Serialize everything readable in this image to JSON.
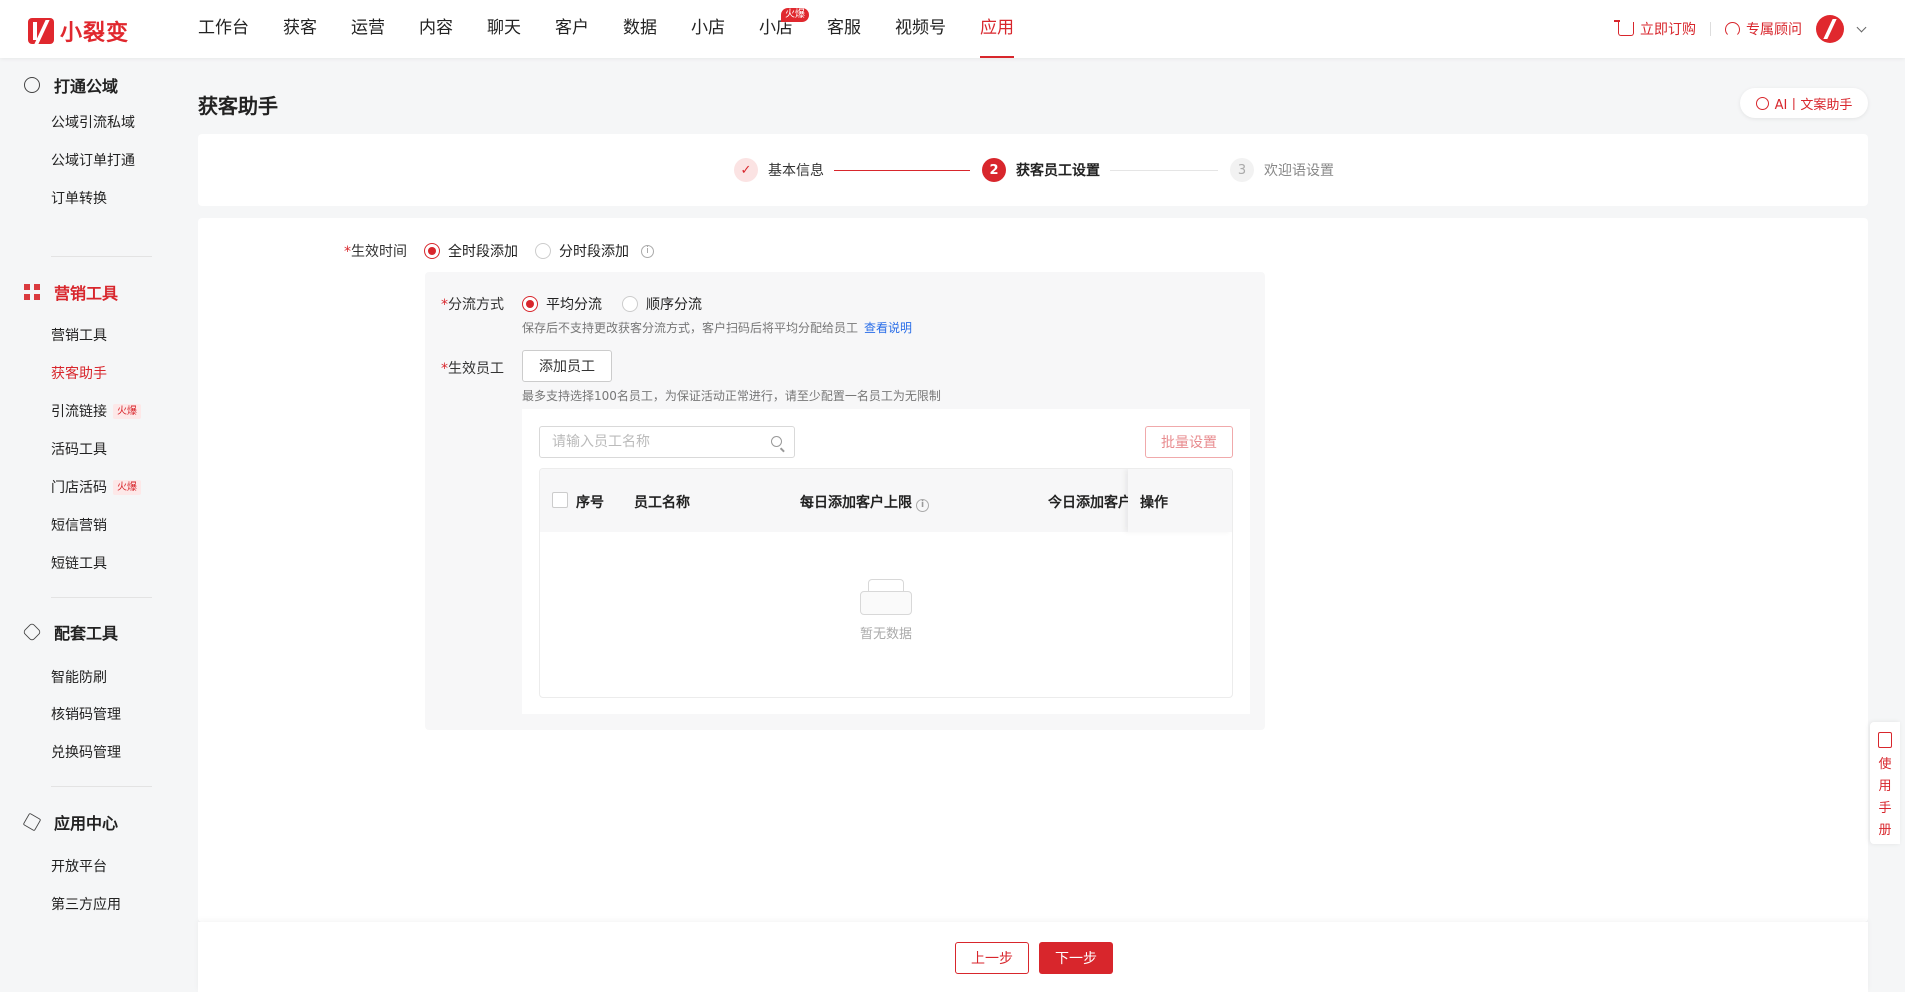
{
  "brand": {
    "name": "小裂变"
  },
  "nav": {
    "items": [
      "工作台",
      "获客",
      "运营",
      "内容",
      "聊天",
      "客户",
      "数据",
      "小店",
      "小店",
      "客服",
      "视频号",
      "应用"
    ],
    "hot_badge": "火爆",
    "active": "应用"
  },
  "top_right": {
    "order": "立即订购",
    "consultant": "专属顾问"
  },
  "sidebar": {
    "groups": [
      {
        "title": "打通公域",
        "items": [
          "公域引流私域",
          "公域订单打通",
          "订单转换"
        ]
      },
      {
        "title": "营销工具",
        "items": [
          "营销工具",
          "获客助手",
          "引流链接",
          "活码工具",
          "门店活码",
          "短信营销",
          "短链工具"
        ]
      },
      {
        "title": "配套工具",
        "items": [
          "智能防刷",
          "核销码管理",
          "兑换码管理"
        ]
      },
      {
        "title": "应用中心",
        "items": [
          "开放平台",
          "第三方应用"
        ]
      }
    ],
    "hot_tag": "火爆",
    "active_item": "获客助手"
  },
  "page": {
    "title": "获客助手",
    "ai_button": "AI丨文案助手"
  },
  "steps": [
    {
      "index": "✓",
      "label": "基本信息",
      "state": "done"
    },
    {
      "index": "2",
      "label": "获客员工设置",
      "state": "current"
    },
    {
      "index": "3",
      "label": "欢迎语设置",
      "state": "waiting"
    }
  ],
  "form": {
    "required_mark": "*",
    "effective_time": {
      "label": "生效时间",
      "options": [
        "全时段添加",
        "分时段添加"
      ],
      "selected": "全时段添加"
    },
    "distribution": {
      "label": "分流方式",
      "options": [
        "平均分流",
        "顺序分流"
      ],
      "selected": "平均分流",
      "hint": "保存后不支持更改获客分流方式，客户扫码后将平均分配给员工",
      "hint_link": "查看说明"
    },
    "staff": {
      "label": "生效员工",
      "add_button": "添加员工",
      "hint": "最多支持选择100名员工，为保证活动正常进行，请至少配置一名员工为无限制",
      "search_placeholder": "请输入员工名称",
      "batch_button": "批量设置",
      "columns": [
        "序号",
        "员工名称",
        "每日添加客户上限",
        "今日添加客户",
        "操作"
      ],
      "empty_text": "暂无数据"
    }
  },
  "footer": {
    "prev": "上一步",
    "next": "下一步"
  },
  "manual": {
    "label": "使用手册"
  },
  "colors": {
    "accent": "#d8262c",
    "link": "#2a6ee8"
  }
}
